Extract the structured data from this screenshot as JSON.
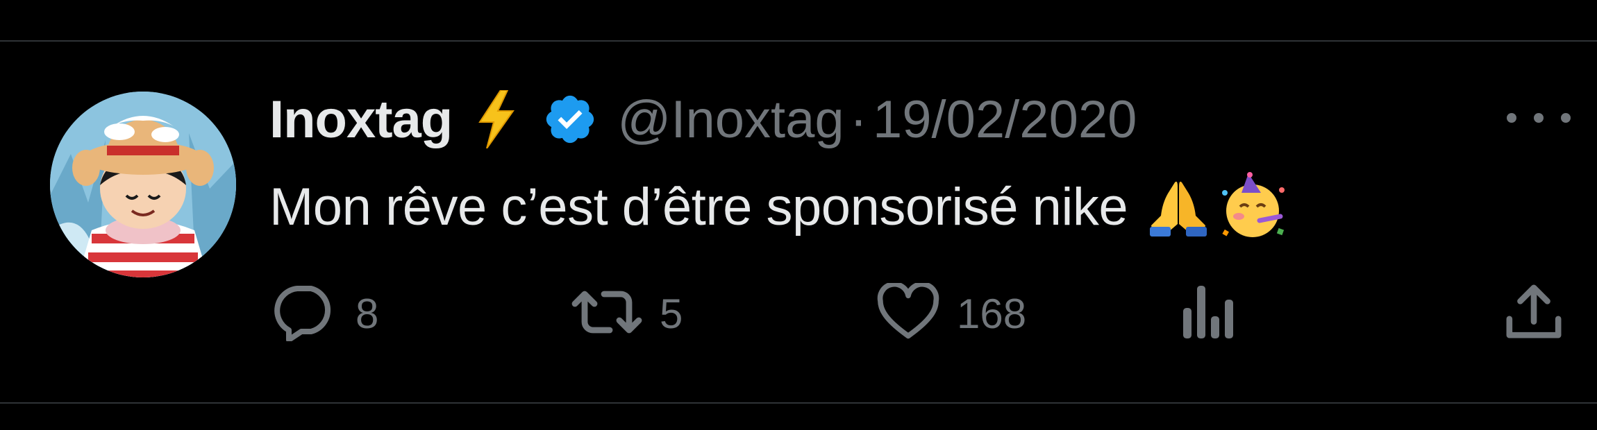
{
  "tweet": {
    "display_name": "Inoxtag",
    "handle": "@Inoxtag",
    "separator": "·",
    "date": "19/02/2020",
    "text": "Mon rêve c’est d’être sponsorisé nike",
    "emojis": [
      "folded-hands-emoji",
      "partying-face-emoji"
    ]
  },
  "actions": {
    "reply_count": "8",
    "retweet_count": "5",
    "like_count": "168"
  },
  "icons": {
    "name_badge": "bolt-icon",
    "verified": "verified-badge-icon",
    "more": "more-options-icon",
    "reply": "reply-icon",
    "retweet": "retweet-icon",
    "like": "heart-icon",
    "views": "views-icon",
    "share": "share-icon"
  },
  "colors": {
    "background": "#000000",
    "primary_text": "#e7e9ea",
    "secondary_text": "#71767b",
    "verified_blue": "#1d9bf0",
    "divider": "#2f3336"
  }
}
